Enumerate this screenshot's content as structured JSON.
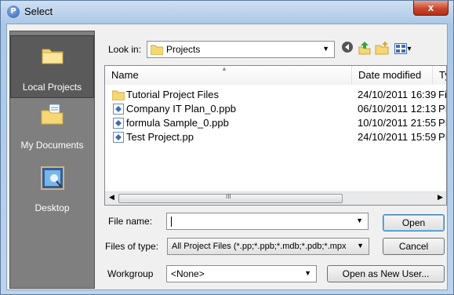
{
  "window": {
    "title": "Select",
    "close_glyph": "x",
    "app_icon_letter": "P"
  },
  "places": [
    {
      "label": "Local Projects",
      "icon": "folder-icon",
      "selected": true
    },
    {
      "label": "My Documents",
      "icon": "documents-folder-icon",
      "selected": false
    },
    {
      "label": "Desktop",
      "icon": "desktop-icon",
      "selected": false
    }
  ],
  "lookin": {
    "label": "Look in:",
    "value": "Projects"
  },
  "toolbar": {
    "view_menu_glyph": "▾"
  },
  "filelist": {
    "headers": [
      "Name",
      "Date modified",
      "Ty"
    ],
    "rows": [
      {
        "name": "Tutorial Project Files",
        "date": "24/10/2011 16:39",
        "type": "Fi",
        "kind": "folder"
      },
      {
        "name": "Company IT Plan_0.ppb",
        "date": "06/10/2011 12:13",
        "type": "PI",
        "kind": "file"
      },
      {
        "name": "formula Sample_0.ppb",
        "date": "10/10/2011 21:55",
        "type": "PI",
        "kind": "file"
      },
      {
        "name": "Test Project.pp",
        "date": "24/10/2011 15:59",
        "type": "PI",
        "kind": "file"
      }
    ],
    "scroll_center_glyph": "III"
  },
  "form": {
    "filename_label": "File name:",
    "filename_value": "",
    "filetype_label": "Files of type:",
    "filetype_value": "All Project Files (*.pp;*.ppb;*.mdb;*.pdb;*.mpx",
    "workgroup_label": "Workgroup",
    "workgroup_value": "<None>"
  },
  "buttons": {
    "open": "Open",
    "cancel": "Cancel",
    "open_new_user": "Open as New User..."
  }
}
